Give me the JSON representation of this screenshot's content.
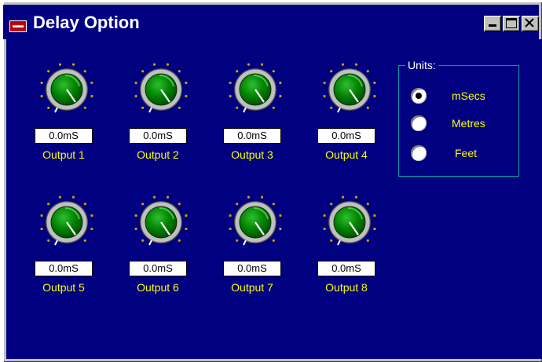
{
  "window": {
    "title": "Delay Option",
    "controls": {
      "minimize": "minimize-icon",
      "maximize": "maximize-icon",
      "close": "close-icon"
    }
  },
  "outputs": [
    {
      "label": "Output 1",
      "value": "0.0mS"
    },
    {
      "label": "Output 2",
      "value": "0.0mS"
    },
    {
      "label": "Output 3",
      "value": "0.0mS"
    },
    {
      "label": "Output 4",
      "value": "0.0mS"
    },
    {
      "label": "Output 5",
      "value": "0.0mS"
    },
    {
      "label": "Output 6",
      "value": "0.0mS"
    },
    {
      "label": "Output 7",
      "value": "0.0mS"
    },
    {
      "label": "Output 8",
      "value": "0.0mS"
    }
  ],
  "units": {
    "legend": "Units:",
    "options": [
      "mSecs",
      "Metres",
      "Feet"
    ],
    "selected": "mSecs"
  },
  "colors": {
    "background": "#000080",
    "label_text": "#ffff00",
    "knob_face": "#008000",
    "knob_ring": "#c0c0c0",
    "tick_dots": "#c8a000",
    "group_border": "#00a0a0"
  }
}
